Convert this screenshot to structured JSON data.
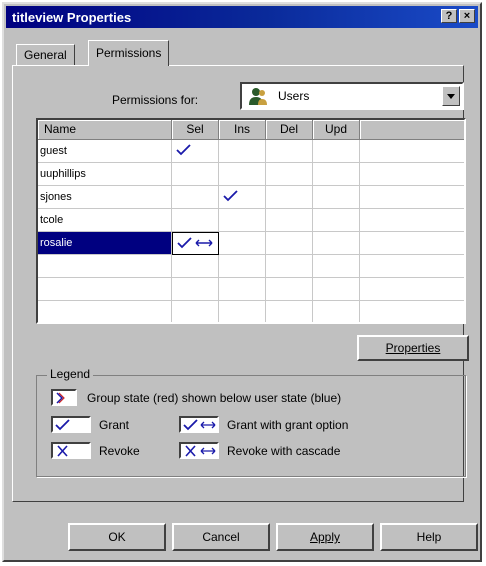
{
  "window": {
    "title": "titleview Properties"
  },
  "title_buttons": {
    "help": "?",
    "close": "×"
  },
  "tabs": [
    {
      "label": "General"
    },
    {
      "label": "Permissions"
    }
  ],
  "permissions_for": {
    "label": "Permissions for:",
    "value": "Users",
    "icon": "users-icon"
  },
  "grid": {
    "columns": [
      "Name",
      "Sel",
      "Ins",
      "Del",
      "Upd"
    ],
    "rows": [
      {
        "name": "guest",
        "sel": "grant",
        "ins": "",
        "del": "",
        "upd": ""
      },
      {
        "name": "uuphillips",
        "sel": "",
        "ins": "",
        "del": "",
        "upd": ""
      },
      {
        "name": "sjones",
        "sel": "",
        "ins": "grant",
        "del": "",
        "upd": ""
      },
      {
        "name": "tcole",
        "sel": "",
        "ins": "",
        "del": "",
        "upd": ""
      },
      {
        "name": "rosalie",
        "sel": "grant-with-grant-option",
        "ins": "",
        "del": "",
        "upd": "",
        "selected": true
      }
    ]
  },
  "buttons": {
    "properties": "Properties",
    "ok": "OK",
    "cancel": "Cancel",
    "apply": "Apply",
    "help": "Help"
  },
  "legend": {
    "title": "Legend",
    "group_state": "Group state (red) shown below user state (blue)",
    "grant": "Grant",
    "revoke": "Revoke",
    "grant_with_grant": "Grant with grant option",
    "revoke_with_cascade": "Revoke with cascade"
  },
  "colors": {
    "titlebar": "#000080",
    "grant_check": "#1a1aaa",
    "selection": "#000080",
    "group_state": "#cc2222"
  }
}
